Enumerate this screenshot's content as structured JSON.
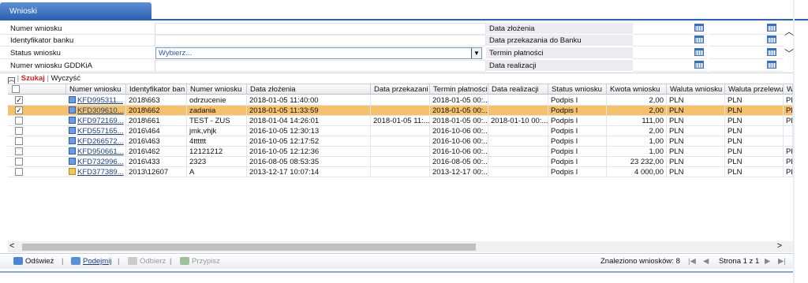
{
  "tab": {
    "title": "Wnioski"
  },
  "filters": {
    "left": [
      "Numer wniosku",
      "Identyfikator banku",
      "Status wniosku",
      "Numer wniosku GDDKiA"
    ],
    "status_value": "Wybierz...",
    "right": [
      "Data złożenia",
      "Data przekazania do Banku",
      "Termin płatności",
      "Data realizacji"
    ]
  },
  "actions": {
    "search": "Szukaj",
    "clear": "Wyczyść"
  },
  "grid": {
    "columns": [
      "Numer wniosku",
      "Identyfikator ban",
      "Numer wniosku",
      "Data złożenia",
      "Data przekazani",
      "Termin płatności",
      "Data realizacji",
      "Status wniosku",
      "Kwota wniosku",
      "Waluta wniosku",
      "Waluta przelewu",
      "W"
    ],
    "rows": [
      {
        "checked": true,
        "selected": false,
        "icon": "blue",
        "cells": [
          "KFD995311...",
          "2018\\663",
          "odrzucenie",
          "2018-01-05 11:40:00",
          "",
          "2018-01-05 00:...",
          "",
          "Podpis I",
          "2,00",
          "PLN",
          "PLN",
          "PL"
        ]
      },
      {
        "checked": true,
        "selected": true,
        "icon": "blue",
        "cells": [
          "KFD309610...",
          "2018\\662",
          "zadania",
          "2018-01-05 11:33:59",
          "",
          "2018-01-05 00:...",
          "",
          "Podpis I",
          "2,00",
          "PLN",
          "PLN",
          "PL"
        ]
      },
      {
        "checked": false,
        "selected": false,
        "icon": "blue",
        "cells": [
          "KFD972169...",
          "2018\\661",
          "TEST - ZUS",
          "2018-01-04 14:26:01",
          "2018-01-05 11:...",
          "2018-01-05 00:...",
          "2018-01-10 00:...",
          "Podpis I",
          "111,00",
          "PLN",
          "PLN",
          "PL"
        ]
      },
      {
        "checked": false,
        "selected": false,
        "icon": "blue",
        "cells": [
          "KFD557165...",
          "2016\\464",
          "jmk,vhjk",
          "2016-10-05 12:30:13",
          "",
          "2016-10-06 00:...",
          "",
          "Podpis I",
          "2,00",
          "PLN",
          "PLN",
          ""
        ]
      },
      {
        "checked": false,
        "selected": false,
        "icon": "blue",
        "cells": [
          "KFD266572...",
          "2016\\463",
          "4tttttt",
          "2016-10-05 12:17:52",
          "",
          "2016-10-06 00:...",
          "",
          "Podpis I",
          "1,00",
          "PLN",
          "PLN",
          ""
        ]
      },
      {
        "checked": false,
        "selected": false,
        "icon": "blue",
        "cells": [
          "KFD950661...",
          "2016\\462",
          "12121212",
          "2016-10-05 12:12:36",
          "",
          "2016-10-06 00:...",
          "",
          "Podpis I",
          "1,00",
          "PLN",
          "PLN",
          "PL"
        ]
      },
      {
        "checked": false,
        "selected": false,
        "icon": "blue",
        "cells": [
          "KFD732996...",
          "2016\\433",
          "2323",
          "2016-08-05 08:53:35",
          "",
          "2016-08-05 00:...",
          "",
          "Podpis I",
          "23 232,00",
          "PLN",
          "PLN",
          "PL"
        ]
      },
      {
        "checked": false,
        "selected": false,
        "icon": "yellow",
        "cells": [
          "KFD377389...",
          "2013\\12607",
          "A",
          "2013-12-17 10:07:14",
          "",
          "2013-12-17 00:...",
          "",
          "Podpis I",
          "4 000,00",
          "PLN",
          "PLN",
          "PL"
        ]
      }
    ]
  },
  "footer": {
    "refresh": "Odśwież",
    "take": "Podejmij",
    "reject": "Odbierz",
    "assign": "Przypisz",
    "found": "Znaleziono wniosków: 8",
    "page": "Strona 1 z 1"
  }
}
